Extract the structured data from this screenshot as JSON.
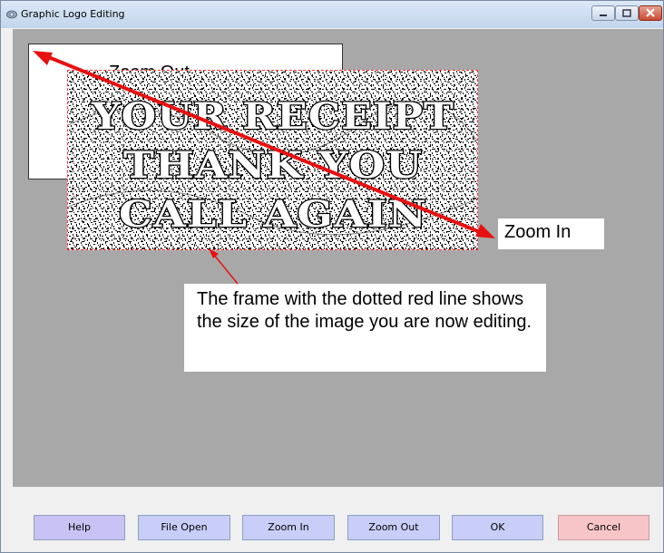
{
  "window": {
    "title": "Graphic Logo Editing",
    "app_icon": "camera-icon"
  },
  "canvas": {
    "logo_lines": [
      "YOUR RECEIPT",
      "THANK YOU",
      "CALL AGAIN"
    ],
    "zoom_out_label": "Zoom Out",
    "zoom_in_label": "Zoom In",
    "note": "The frame with the dotted red line shows the size of the image you are now editing.",
    "frame_color": "#ff3030",
    "arrow_color": "#e81010"
  },
  "buttons": {
    "help": "Help",
    "file_open": "File Open",
    "zoom_in": "Zoom In",
    "zoom_out": "Zoom Out",
    "ok": "OK",
    "cancel": "Cancel"
  }
}
